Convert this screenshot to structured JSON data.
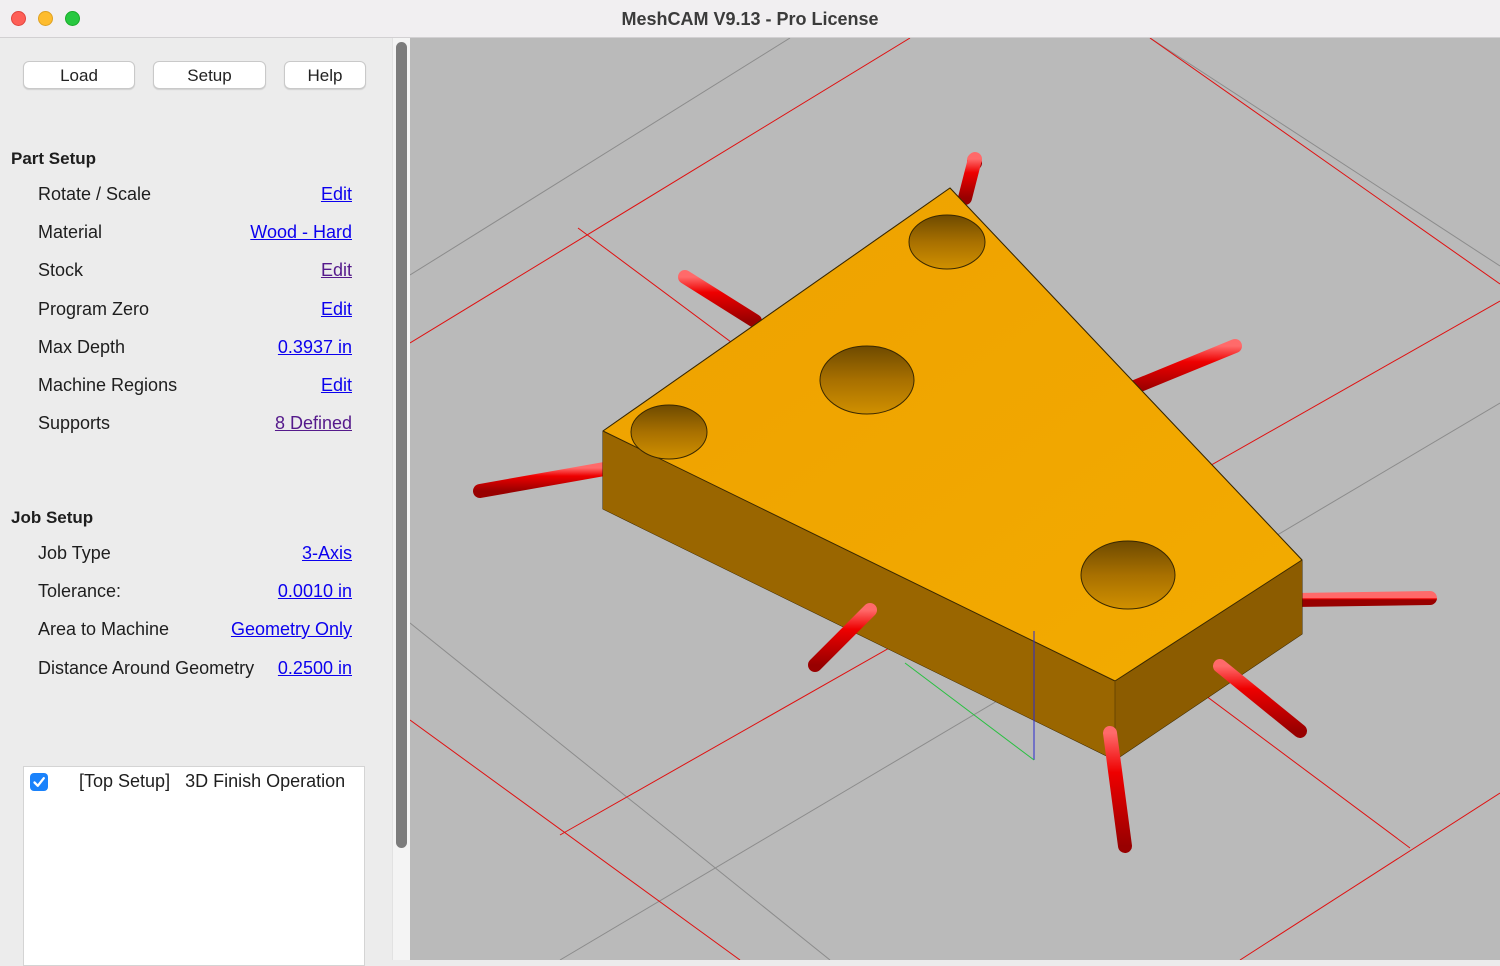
{
  "window": {
    "title": "MeshCAM V9.13 - Pro License"
  },
  "toolbar": {
    "load": "Load",
    "setup": "Setup",
    "help": "Help"
  },
  "part_setup": {
    "title": "Part Setup",
    "rows": [
      {
        "label": "Rotate / Scale",
        "value": "Edit"
      },
      {
        "label": "Material",
        "value": "Wood - Hard"
      },
      {
        "label": "Stock",
        "value": "Edit"
      },
      {
        "label": "Program Zero",
        "value": "Edit"
      },
      {
        "label": "Max Depth",
        "value": "0.3937 in"
      },
      {
        "label": "Machine Regions",
        "value": "Edit"
      },
      {
        "label": "Supports",
        "value": "8 Defined"
      }
    ]
  },
  "job_setup": {
    "title": "Job Setup",
    "rows": [
      {
        "label": "Job Type",
        "value": "3-Axis"
      },
      {
        "label": "Tolerance:",
        "value": "0.0010 in"
      },
      {
        "label": "Area to Machine",
        "value": "Geometry Only"
      },
      {
        "label": "Distance Around Geometry",
        "value": "0.2500 in"
      }
    ]
  },
  "operations": [
    {
      "checked": true,
      "setup": "[Top Setup]",
      "name": "3D Finish Operation"
    }
  ],
  "colors": {
    "link": "#0b00ee",
    "link_visited": "#551a8b",
    "part_top": "#f0a400",
    "part_side": "#a87000",
    "supports": "#ee0000",
    "viewport_bg": "#bababa",
    "grid_red": "#e01010",
    "checkbox": "#1a82fb"
  }
}
